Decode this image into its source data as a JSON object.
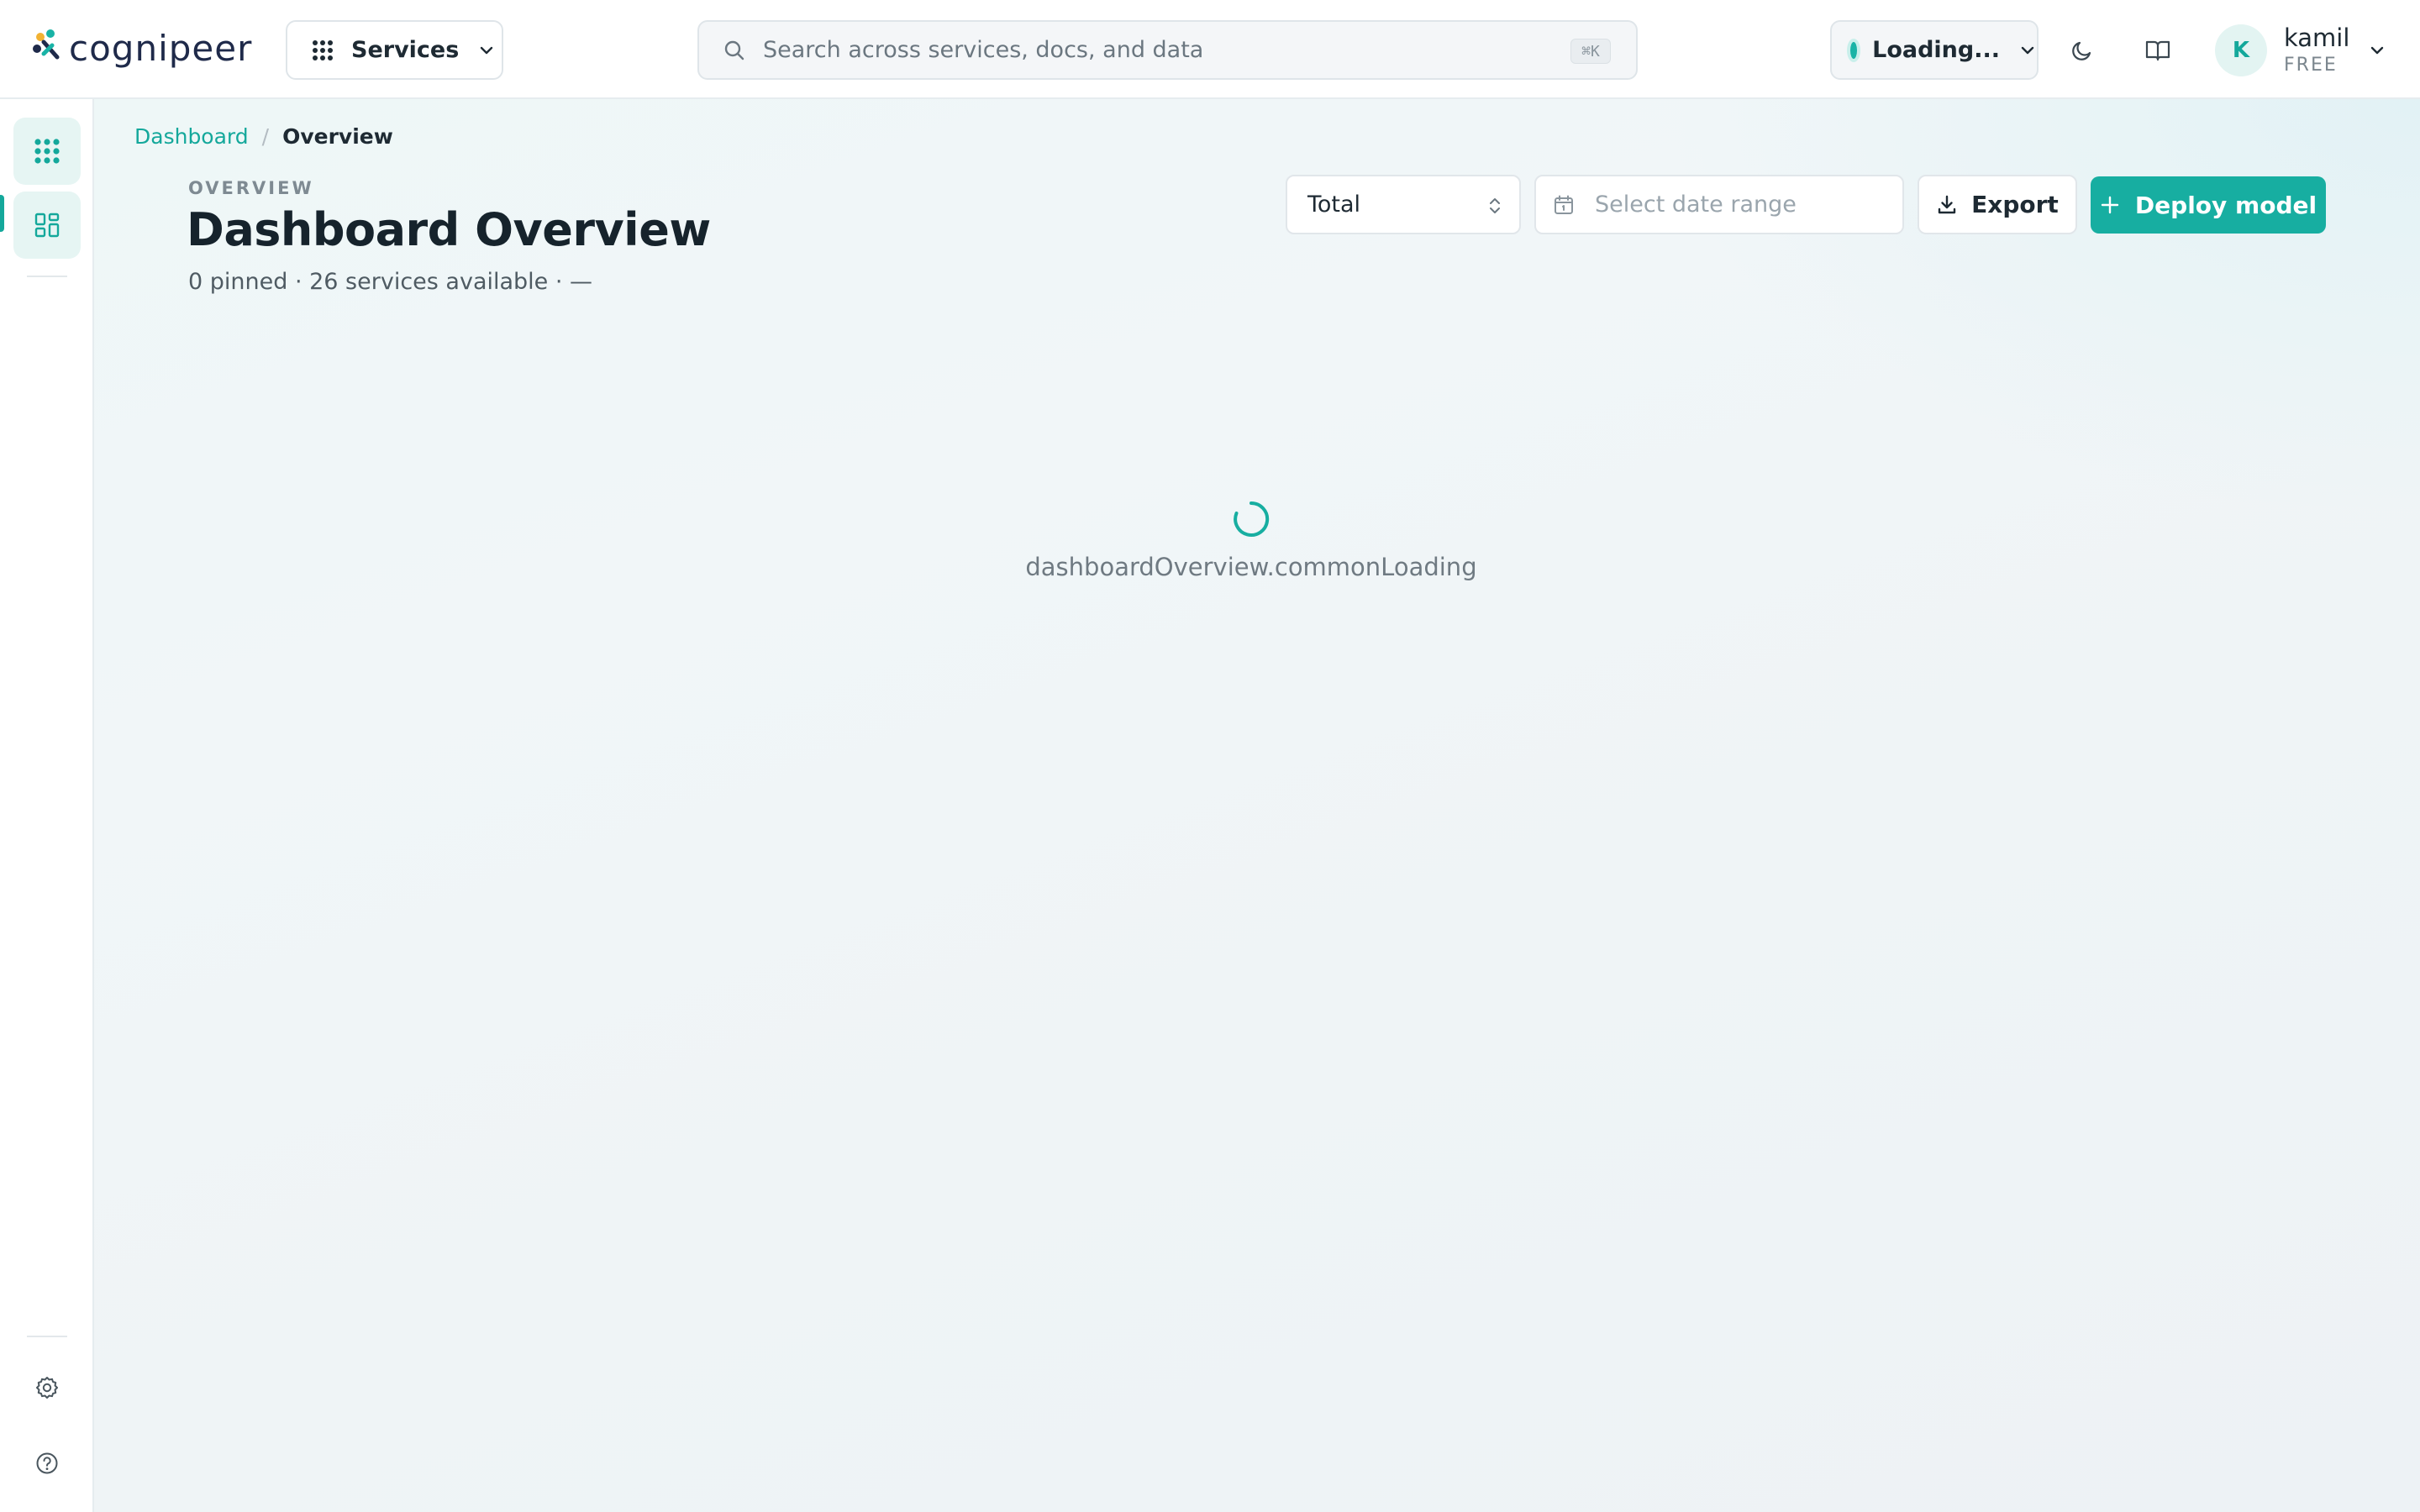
{
  "app": {
    "brand": "cognipeer",
    "accent_color": "#14a89b",
    "primary_button_color": "#17aea1"
  },
  "topbar": {
    "services_label": "Services",
    "search_placeholder": "Search across services, docs, and data",
    "search_shortcut": "⌘K",
    "environment_label": "Loading...",
    "theme_toggle_icon": "moon-icon",
    "docs_icon": "book-icon",
    "user": {
      "initial": "K",
      "name": "kamil",
      "plan": "FREE"
    }
  },
  "sidebar": {
    "items": [
      {
        "name": "services-grid",
        "icon": "dots-grid-icon",
        "active": false
      },
      {
        "name": "dashboard",
        "icon": "dashboard-icon",
        "active": true
      }
    ],
    "bottom_items": [
      {
        "name": "settings",
        "icon": "gear-icon"
      },
      {
        "name": "help",
        "icon": "help-circle-icon"
      }
    ]
  },
  "breadcrumb": {
    "items": [
      "Dashboard",
      "Overview"
    ],
    "separator": "/"
  },
  "header": {
    "eyebrow": "OVERVIEW",
    "title": "Dashboard Overview",
    "subtitle": "0 pinned · 26 services available · —"
  },
  "controls": {
    "aggregation_select": {
      "value": "Total"
    },
    "date_range": {
      "placeholder": "Select date range"
    },
    "export_label": "Export",
    "deploy_label": "Deploy model"
  },
  "content": {
    "loading_text": "dashboardOverview.commonLoading"
  }
}
